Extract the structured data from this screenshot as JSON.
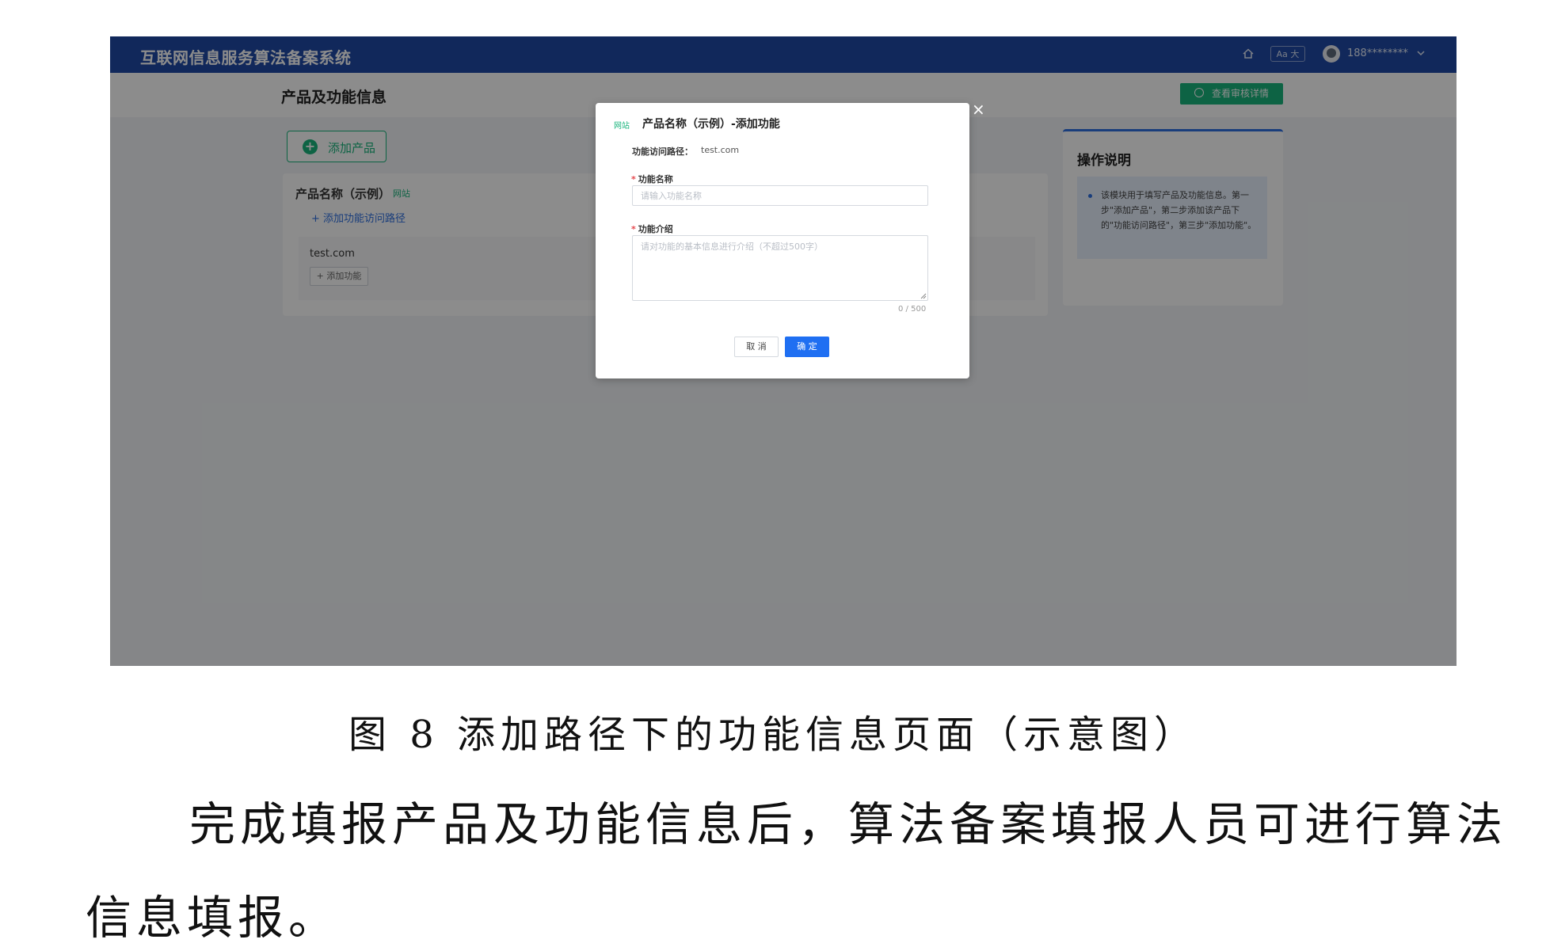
{
  "app": {
    "system_title": "互联网信息服务算法备案系统",
    "font_toggle": "Aa 大",
    "user_name": "188********"
  },
  "page": {
    "title": "产品及功能信息",
    "audit_button": "查看审核详情",
    "add_product_button": "添加产品"
  },
  "product": {
    "name": "产品名称（示例）",
    "tag": "网站",
    "add_path_link": "+ 添加功能访问路径",
    "path_url": "test.com",
    "add_function_button": "+ 添加功能"
  },
  "help": {
    "title": "操作说明",
    "text": "该模块用于填写产品及功能信息。第一步\"添加产品\"，第二步添加该产品下的\"功能访问路径\"，第三步\"添加功能\"。"
  },
  "modal": {
    "tag": "网站",
    "title": "产品名称（示例）-添加功能",
    "path_label": "功能访问路径：",
    "path_value": "test.com",
    "name_label": "功能名称",
    "name_placeholder": "请输入功能名称",
    "desc_label": "功能介绍",
    "desc_placeholder": "请对功能的基本信息进行介绍（不超过500字）",
    "counter": "0 / 500",
    "cancel_button": "取 消",
    "confirm_button": "确 定"
  },
  "document": {
    "caption": "图 8 添加路径下的功能信息页面（示意图）",
    "paragraph_line1": "完成填报产品及功能信息后，算法备案填报人员可进行算法",
    "paragraph_line2": "信息填报。"
  },
  "colors": {
    "topbar": "#1f4aa6",
    "accent_green": "#19b47c",
    "primary_blue": "#1f6ff2"
  }
}
